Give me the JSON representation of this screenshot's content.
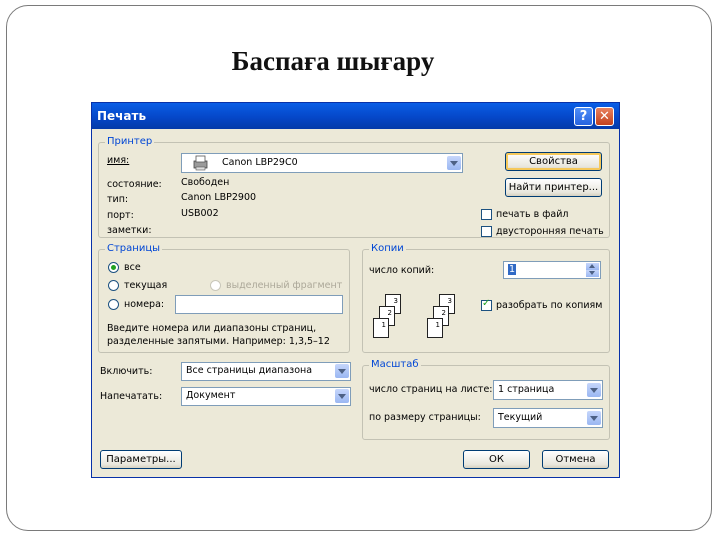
{
  "slide": {
    "title": "Баспаға шығару"
  },
  "dialog": {
    "title": "Печать",
    "help_glyph": "?",
    "close_glyph": "✕",
    "printer": {
      "legend": "Принтер",
      "name_label": "имя:",
      "name_value": "Canon LBP29C0",
      "status_label": "состояние:",
      "status_value": "Свободен",
      "type_label": "тип:",
      "type_value": "Canon LBP2900",
      "port_label": "порт:",
      "port_value": "USB002",
      "notes_label": "заметки:",
      "properties_button": "Свойства",
      "find_printer_button": "Найти принтер...",
      "print_to_file": "печать в файл",
      "duplex": "двусторонняя печать"
    },
    "pages": {
      "legend": "Страницы",
      "all": "все",
      "current": "текущая",
      "selection": "выделенный фрагмент",
      "numbers": "номера:",
      "hint": "Введите номера или диапазоны страниц, разделенные запятыми. Например: 1,3,5–12",
      "hint_line1": "Введите номера или диапазоны страниц,",
      "hint_line2": "разделенные запятыми. Например: 1,3,5–12"
    },
    "copies": {
      "legend": "Копии",
      "count_label": "число копий:",
      "count_value": "1",
      "collate": "разобрать по копиям",
      "collate_checked": true,
      "stack_pages": [
        "3",
        "2",
        "1"
      ]
    },
    "include": {
      "label": "Включить:",
      "value": "Все страницы диапазона"
    },
    "print_what": {
      "label": "Напечатать:",
      "value": "Документ"
    },
    "zoom": {
      "legend": "Масштаб",
      "pages_per_sheet_label": "число страниц на листе:",
      "pages_per_sheet_value": "1 страница",
      "scale_label": "по размеру страницы:",
      "scale_value": "Текущий"
    },
    "buttons": {
      "options": "Параметры...",
      "ok": "ОК",
      "cancel": "Отмена"
    }
  },
  "colors": {
    "titlebar": "#0547c8",
    "dialog_bg": "#ece9d8",
    "legend": "#0046d5"
  }
}
